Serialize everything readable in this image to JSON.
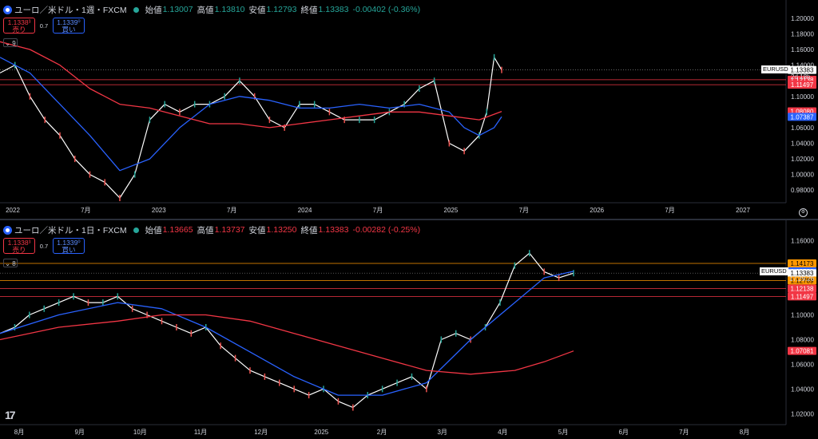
{
  "top": {
    "symbol": "ユーロ／米ドル・1週・FXCM",
    "ohlc": {
      "open_label": "始値",
      "open": "1.13007",
      "high_label": "高値",
      "high": "1.13810",
      "low_label": "安値",
      "low": "1.12793",
      "close_label": "終値",
      "close": "1.13383",
      "change": "-0.00402 (-0.36%)"
    },
    "sell_price": "1.1338³",
    "sell_label": "売り",
    "spread": "0.7",
    "buy_price": "1.1339⁰",
    "buy_label": "買い",
    "indicator_count": "9",
    "countdown": "2d 18h",
    "symbol_tag": "EURUSD",
    "time_labels": [
      "2022",
      "7月",
      "2023",
      "7月",
      "2024",
      "7月",
      "2025",
      "7月",
      "2026",
      "7月",
      "2027"
    ]
  },
  "bottom": {
    "symbol": "ユーロ／米ドル・1日・FXCM",
    "ohlc": {
      "open_label": "始値",
      "open": "1.13665",
      "high_label": "高値",
      "high": "1.13737",
      "low_label": "安値",
      "low": "1.13250",
      "close_label": "終値",
      "close": "1.13383",
      "change": "-0.00282 (-0.25%)"
    },
    "sell_price": "1.1338³",
    "sell_label": "売り",
    "spread": "0.7",
    "buy_price": "1.1339⁰",
    "buy_label": "買い",
    "indicator_count": "8",
    "countdown": "17:29:26",
    "symbol_tag": "EURUSD",
    "time_labels": [
      "8月",
      "9月",
      "10月",
      "11月",
      "12月",
      "2025",
      "2月",
      "3月",
      "4月",
      "5月",
      "6月",
      "7月",
      "8月"
    ]
  },
  "chart_data": [
    {
      "type": "line",
      "pane": "top",
      "title": "ユーロ／米ドル・1週・FXCM",
      "ylim": [
        0.97,
        1.205
      ],
      "xlim": [
        2022.0,
        2027.1
      ],
      "yticks": [
        "1.20000",
        "1.18000",
        "1.16000",
        "1.14000",
        "1.12000",
        "1.10000",
        "1.08000",
        "1.06000",
        "1.04000",
        "1.02000",
        "1.00000",
        "0.98000"
      ],
      "series": [
        {
          "role": "price",
          "color": "#ffffff",
          "x": [
            2022.0,
            2022.1,
            2022.2,
            2022.3,
            2022.4,
            2022.5,
            2022.6,
            2022.7,
            2022.8,
            2022.9,
            2023.0,
            2023.1,
            2023.2,
            2023.3,
            2023.4,
            2023.5,
            2023.6,
            2023.7,
            2023.8,
            2023.9,
            2024.0,
            2024.1,
            2024.2,
            2024.3,
            2024.4,
            2024.5,
            2024.6,
            2024.7,
            2024.8,
            2024.9,
            2025.0,
            2025.1,
            2025.2,
            2025.25,
            2025.3,
            2025.35
          ],
          "y": [
            1.13,
            1.14,
            1.1,
            1.07,
            1.05,
            1.02,
            1.0,
            0.99,
            0.97,
            1.0,
            1.07,
            1.09,
            1.08,
            1.09,
            1.09,
            1.1,
            1.12,
            1.1,
            1.07,
            1.06,
            1.09,
            1.09,
            1.08,
            1.07,
            1.07,
            1.07,
            1.08,
            1.09,
            1.11,
            1.12,
            1.04,
            1.03,
            1.05,
            1.08,
            1.15,
            1.13383
          ]
        },
        {
          "role": "ma-short",
          "color": "#2962ff",
          "x": [
            2022.0,
            2022.2,
            2022.4,
            2022.6,
            2022.8,
            2023.0,
            2023.2,
            2023.4,
            2023.6,
            2023.8,
            2024.0,
            2024.2,
            2024.4,
            2024.6,
            2024.8,
            2025.0,
            2025.1,
            2025.2,
            2025.3,
            2025.35
          ],
          "y": [
            1.15,
            1.13,
            1.09,
            1.05,
            1.005,
            1.02,
            1.06,
            1.09,
            1.1,
            1.095,
            1.085,
            1.085,
            1.09,
            1.085,
            1.09,
            1.08,
            1.06,
            1.05,
            1.06,
            1.07387
          ]
        },
        {
          "role": "ma-long",
          "color": "#f23645",
          "x": [
            2022.0,
            2022.2,
            2022.4,
            2022.6,
            2022.8,
            2023.0,
            2023.2,
            2023.4,
            2023.6,
            2023.8,
            2024.0,
            2024.2,
            2024.4,
            2024.6,
            2024.8,
            2025.0,
            2025.2,
            2025.35
          ],
          "y": [
            1.17,
            1.16,
            1.14,
            1.11,
            1.09,
            1.085,
            1.075,
            1.065,
            1.065,
            1.06,
            1.065,
            1.07,
            1.075,
            1.08,
            1.08,
            1.075,
            1.07,
            1.0808
          ]
        }
      ],
      "price_tags": [
        {
          "value": "1.13383",
          "color": "#ffffff",
          "text_color": "#000000"
        },
        {
          "value": "1.12138",
          "color": "#f23645",
          "text_color": "#ffffff"
        },
        {
          "value": "1.11497",
          "color": "#f23645",
          "text_color": "#ffffff"
        },
        {
          "value": "1.08080",
          "color": "#f23645",
          "text_color": "#ffffff"
        },
        {
          "value": "1.07387",
          "color": "#2962ff",
          "text_color": "#ffffff"
        }
      ],
      "hlines": [
        1.12138,
        1.11497
      ]
    },
    {
      "type": "line",
      "pane": "bottom",
      "title": "ユーロ／米ドル・1日・FXCM",
      "ylim": [
        1.015,
        1.165
      ],
      "yticks": [
        "1.16000",
        "1.14000",
        "1.12000",
        "1.10000",
        "1.08000",
        "1.06000",
        "1.04000",
        "1.02000"
      ],
      "series": [
        {
          "role": "price",
          "color": "#ffffff",
          "x": [
            0,
            5,
            10,
            15,
            20,
            25,
            30,
            35,
            40,
            45,
            50,
            55,
            60,
            65,
            70,
            75,
            80,
            85,
            90,
            95,
            100,
            105,
            110,
            115,
            120,
            125,
            130,
            135,
            140,
            145,
            150,
            155,
            160,
            165,
            170,
            175,
            180,
            185,
            190,
            195
          ],
          "y": [
            1.085,
            1.09,
            1.1,
            1.105,
            1.11,
            1.115,
            1.11,
            1.11,
            1.115,
            1.105,
            1.1,
            1.095,
            1.09,
            1.085,
            1.09,
            1.075,
            1.065,
            1.055,
            1.05,
            1.045,
            1.04,
            1.035,
            1.04,
            1.03,
            1.025,
            1.035,
            1.04,
            1.045,
            1.05,
            1.04,
            1.08,
            1.085,
            1.08,
            1.09,
            1.11,
            1.14,
            1.15,
            1.135,
            1.13,
            1.13383
          ]
        },
        {
          "role": "ma-short",
          "color": "#2962ff",
          "x": [
            0,
            20,
            40,
            55,
            70,
            85,
            100,
            115,
            130,
            145,
            160,
            175,
            185,
            195
          ],
          "y": [
            1.085,
            1.1,
            1.11,
            1.105,
            1.09,
            1.07,
            1.05,
            1.035,
            1.035,
            1.045,
            1.08,
            1.11,
            1.13,
            1.13531
          ]
        },
        {
          "role": "ma-long",
          "color": "#f23645",
          "x": [
            0,
            20,
            40,
            55,
            70,
            85,
            100,
            115,
            130,
            145,
            160,
            175,
            185,
            195
          ],
          "y": [
            1.08,
            1.09,
            1.095,
            1.1,
            1.1,
            1.095,
            1.085,
            1.075,
            1.065,
            1.055,
            1.052,
            1.055,
            1.062,
            1.07081
          ]
        }
      ],
      "price_tags": [
        {
          "value": "1.14173",
          "color": "#ff9800",
          "text_color": "#000000"
        },
        {
          "value": "1.13531",
          "color": "#2962ff",
          "text_color": "#ffffff"
        },
        {
          "value": "1.13383",
          "color": "#ffffff",
          "text_color": "#000000"
        },
        {
          "value": "1.12789",
          "color": "#ff9800",
          "text_color": "#000000"
        },
        {
          "value": "1.12138",
          "color": "#f23645",
          "text_color": "#ffffff"
        },
        {
          "value": "1.11497",
          "color": "#f23645",
          "text_color": "#ffffff"
        },
        {
          "value": "1.07081",
          "color": "#f23645",
          "text_color": "#ffffff"
        }
      ],
      "hlines": [
        1.14173,
        1.12789,
        1.12138,
        1.11497
      ]
    }
  ]
}
